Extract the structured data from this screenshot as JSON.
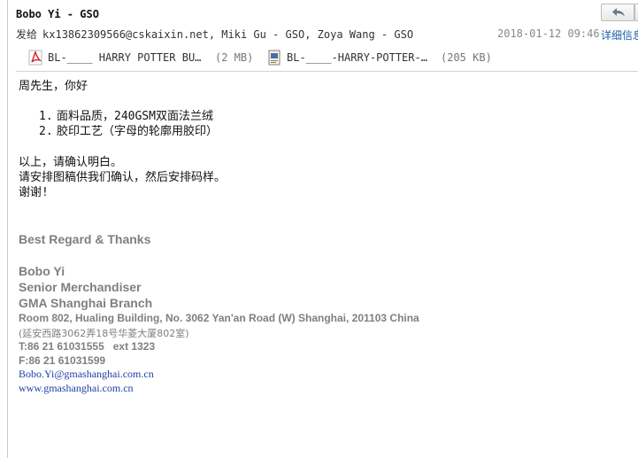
{
  "header": {
    "sender": "Bobo Yi - GSO",
    "recipients_label": "发给",
    "recipients": "kx13862309566@cskaixin.net, Miki Gu - GSO, Zoya Wang - GSO",
    "date": "2018-01-12 09:46",
    "details_label": "详细信息",
    "reply_icon": "reply-arrow-icon"
  },
  "attachments": [
    {
      "icon": "pdf-icon",
      "name": "BL-____ HARRY POTTER BU…",
      "size": "(2 MB)"
    },
    {
      "icon": "document-icon",
      "name": "BL-____-HARRY-POTTER-…",
      "size": "(205 KB)"
    }
  ],
  "body": {
    "greeting": "周先生，你好",
    "list": [
      {
        "num": "1.",
        "text": "面料品质，240GSM双面法兰绒"
      },
      {
        "num": "2.",
        "text": "胶印工艺（字母的轮廓用胶印）"
      }
    ],
    "line1": "以上，请确认明白。",
    "line2": "请安排图稿供我们确认，然后安排码样。",
    "line3": "谢谢!"
  },
  "signature": {
    "regards": "Best Regard & Thanks",
    "name": "Bobo Yi",
    "title": "Senior Merchandiser",
    "branch": "GMA Shanghai Branch",
    "address": "Room 802, Hualing Building, No. 3062 Yan'an Road (W) Shanghai, 201103 China",
    "address_cn": "(延安西路3062弄18号华菱大厦802室)",
    "tel": "T:86 21 61031555   ext 1323",
    "fax": "F:86 21 61031599",
    "email": "Bobo.Yi@gmashanghai.com.cn",
    "website": "www.gmashanghai.com.cn"
  },
  "colors": {
    "link": "#1e3fa8",
    "signature_gray": "#7f7f7f",
    "date_gray": "#888888",
    "pdf_red": "#d3202b"
  }
}
